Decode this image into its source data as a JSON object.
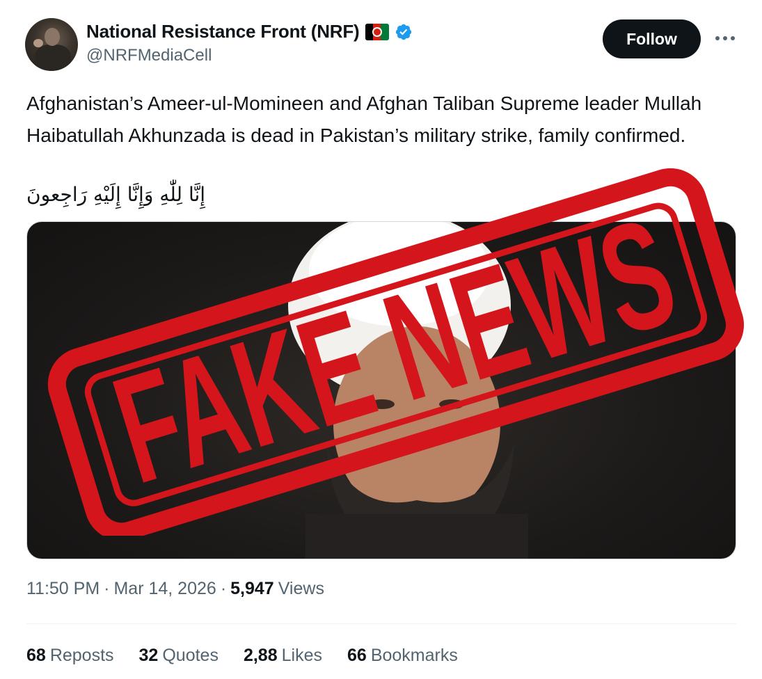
{
  "author": {
    "display_name": "National Resistance Front (NRF)",
    "handle": "@NRFMediaCell",
    "verified": true
  },
  "follow_label": "Follow",
  "more_icon": "more-horizontal-icon",
  "tweet": {
    "text": "Afghanistan’s Ameer-ul-Momineen and Afghan Taliban Supreme leader Mullah Haibatullah Akhunzada is dead in Pakistan’s military strike, family confirmed.",
    "arabic": "إِنَّا لِلّٰهِ وَإِنَّا إِلَيْهِ رَاجِعونَ"
  },
  "media": {
    "stamp_text": "FAKE NEWS",
    "stamp_color": "#d4161c"
  },
  "meta": {
    "time": "11:50 PM",
    "date": "Mar 14, 2026",
    "views_count": "5,947",
    "views_label": "Views"
  },
  "stats": [
    {
      "count": "68",
      "label": "Reposts"
    },
    {
      "count": "32",
      "label": "Quotes"
    },
    {
      "count": "2,88",
      "label": "Likes"
    },
    {
      "count": "66",
      "label": "Bookmarks"
    }
  ],
  "colors": {
    "text_primary": "#0f1419",
    "text_secondary": "#536471",
    "verified_blue": "#1d9bf0",
    "follow_bg": "#0f1419"
  }
}
